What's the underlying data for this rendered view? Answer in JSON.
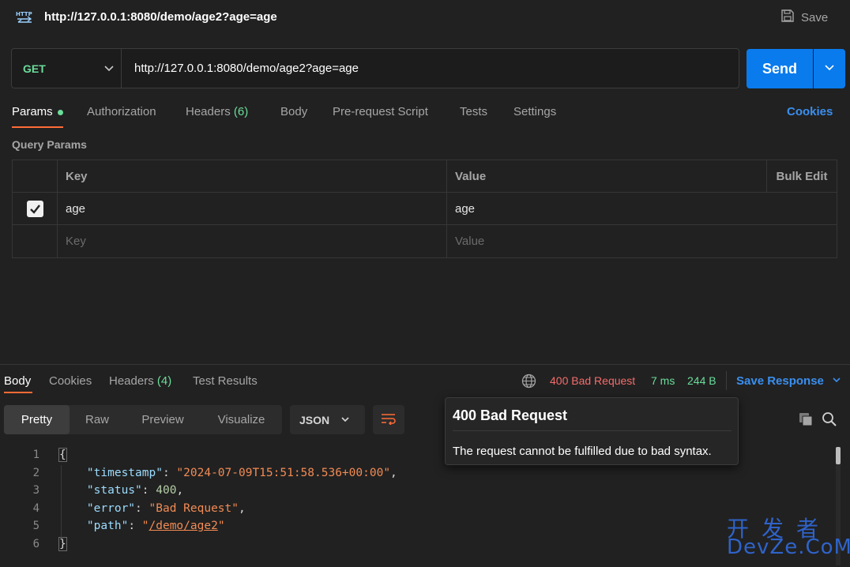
{
  "title": {
    "url": "http://127.0.0.1:8080/demo/age2?age=age",
    "save_label": "Save"
  },
  "request": {
    "method": "GET",
    "url": "http://127.0.0.1:8080/demo/age2?age=age",
    "send_label": "Send"
  },
  "req_tabs": {
    "params": "Params",
    "authorization": "Authorization",
    "headers": "Headers",
    "headers_count": "(6)",
    "body": "Body",
    "prerequest": "Pre-request Script",
    "tests": "Tests",
    "settings": "Settings",
    "cookies": "Cookies"
  },
  "query_params": {
    "label": "Query Params",
    "columns": {
      "key": "Key",
      "value": "Value",
      "bulk_edit": "Bulk Edit"
    },
    "rows": [
      {
        "checked": true,
        "key": "age",
        "value": "age"
      }
    ],
    "placeholder": {
      "key": "Key",
      "value": "Value"
    }
  },
  "response": {
    "tabs": {
      "body": "Body",
      "cookies": "Cookies",
      "headers": "Headers",
      "headers_count": "(4)",
      "test_results": "Test Results"
    },
    "status": "400 Bad Request",
    "time": "7 ms",
    "size": "244 B",
    "save_response": "Save Response",
    "formats": {
      "pretty": "Pretty",
      "raw": "Raw",
      "preview": "Preview",
      "visualize": "Visualize"
    },
    "lang": "JSON",
    "lines": {
      "n1": "1",
      "n2": "2",
      "n3": "3",
      "n4": "4",
      "n5": "5",
      "n6": "6",
      "open": "{",
      "close": "}",
      "timestamp_key": "\"timestamp\"",
      "timestamp_val": "\"2024-07-09T15:51:58.536+00:00\"",
      "status_key": "\"status\"",
      "status_val": "400",
      "error_key": "\"error\"",
      "error_val": "\"Bad Request\"",
      "path_key": "\"path\"",
      "path_q1": "\"",
      "path_val": "/demo/age2",
      "path_q2": "\""
    }
  },
  "tooltip": {
    "title": "400 Bad Request",
    "body": "The request cannot be fulfilled due to bad syntax."
  },
  "watermark": {
    "cn": "开发者",
    "en": "DevZe.CoM"
  },
  "colors": {
    "accent": "#ff6c37",
    "send": "#097bed",
    "link": "#3a8fef",
    "success": "#6bdd9a",
    "error": "#f56c6c"
  }
}
